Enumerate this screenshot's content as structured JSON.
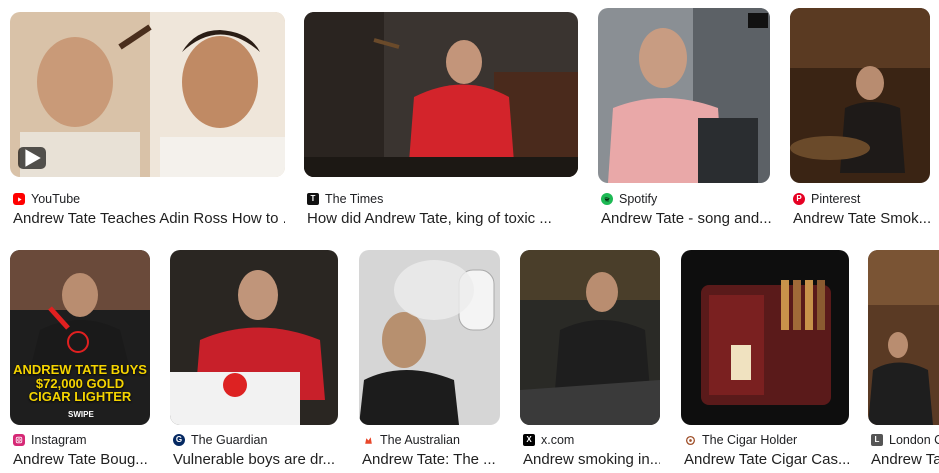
{
  "results": [
    {
      "source": "YouTube",
      "title": "Andrew Tate Teaches Adin Ross How to ...",
      "favicon": "youtube-icon",
      "color": "#ff0000"
    },
    {
      "source": "The Times",
      "title": "How did Andrew Tate, king of toxic ...",
      "favicon": "the-times-icon",
      "color": "#111111"
    },
    {
      "source": "Spotify",
      "title": "Andrew Tate - song and...",
      "favicon": "spotify-icon",
      "color": "#1db954"
    },
    {
      "source": "Pinterest",
      "title": "Andrew Tate Smok...",
      "favicon": "pinterest-icon",
      "color": "#e60023"
    },
    {
      "source": "Instagram",
      "title": "Andrew Tate Boug...",
      "favicon": "instagram-icon",
      "color": "#d62976"
    },
    {
      "source": "The Guardian",
      "title": "Vulnerable boys are dr...",
      "favicon": "the-guardian-icon",
      "color": "#052962"
    },
    {
      "source": "The Australian",
      "title": "Andrew Tate: The ...",
      "favicon": "the-australian-icon",
      "color": "#e8472a"
    },
    {
      "source": "x.com",
      "title": "Andrew smoking in...",
      "favicon": "x-icon",
      "color": "#000000"
    },
    {
      "source": "The Cigar Holder",
      "title": "Andrew Tate Cigar Cas...",
      "favicon": "the-cigar-holder-icon",
      "color": "#a0522d"
    },
    {
      "source": "London C",
      "title": "Andrew Tat",
      "favicon": "london-icon",
      "color": "#555555"
    }
  ],
  "instagram_overlay": {
    "line1": "ANDREW TATE BUYS",
    "line2": "$72,000 GOLD",
    "line3": "CIGAR LIGHTER",
    "swipe": "SWIPE"
  }
}
